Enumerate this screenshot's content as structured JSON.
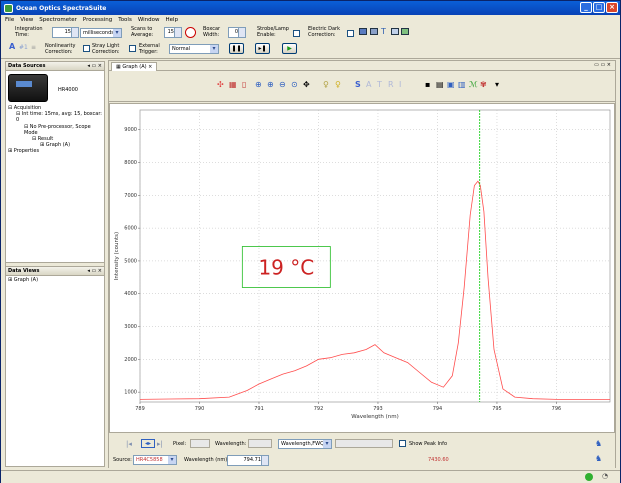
{
  "window": {
    "title": "Ocean Optics SpectraSuite"
  },
  "menu": [
    "File",
    "View",
    "Spectrometer",
    "Processing",
    "Tools",
    "Window",
    "Help"
  ],
  "toolbar": {
    "integration_label": "Integration Time:",
    "integration_value": "15",
    "integration_unit": "milliseconds",
    "scans_label": "Scans to Average:",
    "scans_value": "15",
    "boxcar_label": "Boxcar Width:",
    "boxcar_value": "0",
    "strobe_label": "Strobe/Lamp Enable:",
    "electric_dark_label": "Electric Dark Correction:",
    "nonlinearity_label": "Nonlinearity Correction:",
    "stray_light_label": "Stray Light Correction:",
    "external_trigger_label": "External Trigger:",
    "trigger_mode": "Normal"
  },
  "data_sources": {
    "title": "Data Sources",
    "device": "HR4000",
    "tree": [
      "Acquisition",
      "Int time: 15ms, avg: 15, boxcar: 0",
      "No Pre-processor, Scope Mode",
      "Result",
      "Graph (A)",
      "Properties"
    ]
  },
  "data_views": {
    "title": "Data Views",
    "items": [
      "Graph (A)"
    ]
  },
  "graph": {
    "tab_label": "Graph (A)",
    "toolbar_letters": [
      "S",
      "A",
      "T",
      "R",
      "I"
    ],
    "annotation": "19 °C",
    "controls": {
      "pixel_label": "Pixel:",
      "wavelength_label": "Wavelength:",
      "mode_value": "Wavelength,FWQM",
      "show_peak_label": "Show Peak Info",
      "source_label": "Source:",
      "source_value": "HR4C5858",
      "wavelength_nm_label": "Wavelength (nm):",
      "wavelength_nm_value": "794.71",
      "intensity_readout": "7430.60"
    }
  },
  "chart_data": {
    "type": "line",
    "xlabel": "Wavelength (nm)",
    "ylabel": "Intensity (counts)",
    "xlim": [
      789,
      796.9
    ],
    "ylim": [
      700,
      9600
    ],
    "x_ticks": [
      789,
      790,
      791,
      792,
      793,
      794,
      795,
      796
    ],
    "y_ticks": [
      1000,
      2000,
      3000,
      4000,
      5000,
      6000,
      7000,
      8000,
      9000
    ],
    "cursor_x": 794.71,
    "colors": {
      "line": "#ff4d4d",
      "cursor": "#00cc00",
      "annotation": "#cc2222"
    },
    "series": [
      {
        "x": [
          789.0,
          789.5,
          790.0,
          790.5,
          790.8,
          791.0,
          791.2,
          791.4,
          791.6,
          791.8,
          792.0,
          792.2,
          792.4,
          792.6,
          792.8,
          792.95,
          793.1,
          793.3,
          793.5,
          793.7,
          793.9,
          794.1,
          794.25,
          794.35,
          794.45,
          794.55,
          794.62,
          794.68,
          794.72,
          794.78,
          794.85,
          794.95,
          795.1,
          795.3,
          795.6,
          796.0,
          796.5,
          796.9
        ],
        "y": [
          780,
          790,
          800,
          850,
          1050,
          1250,
          1400,
          1550,
          1650,
          1800,
          2000,
          2050,
          2150,
          2200,
          2300,
          2450,
          2200,
          2050,
          1900,
          1600,
          1300,
          1150,
          1500,
          2500,
          4200,
          6400,
          7300,
          7430,
          7300,
          6500,
          4500,
          2300,
          1100,
          850,
          800,
          780,
          780,
          780
        ]
      }
    ]
  }
}
